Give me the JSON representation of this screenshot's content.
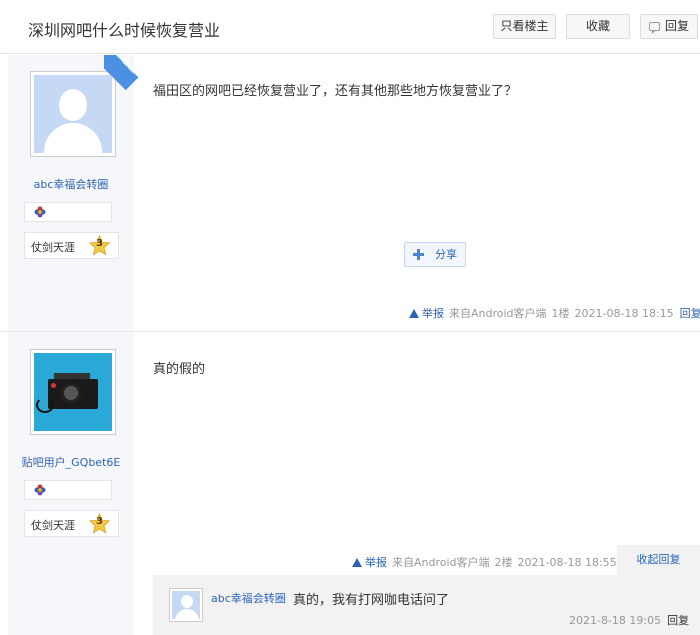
{
  "header": {
    "title": "深圳网吧什么时候恢复营业",
    "only_op_label": "只看楼主",
    "favorite_label": "收藏",
    "reply_label": "回复"
  },
  "posts": [
    {
      "username": "abc幸福会转圈",
      "level_name": "仗剑天涯",
      "level": "3",
      "op_badge": "楼主",
      "content": "福田区的网吧已经恢复营业了，还有其他那些地方恢复营业了？",
      "share_label": "分享",
      "report_label": "举报",
      "client": "来自Android客户端",
      "floor": "1楼",
      "time": "2021-08-18 18:15",
      "reply_label": "回复"
    },
    {
      "username": "贴吧用户_GQbet6E",
      "level_name": "仗剑天涯",
      "level": "3",
      "content": "真的假的",
      "report_label": "举报",
      "client": "来自Android客户端",
      "floor": "2楼",
      "time": "2021-08-18 18:55",
      "collapse_label": "收起回复",
      "subreply": {
        "username": "abc幸福会转圈",
        "text": "真的，我有打网咖电话问了",
        "time": "2021-8-18 19:05",
        "reply_label": "回复"
      }
    }
  ],
  "colors": {
    "link": "#2d64b3",
    "sidebar": "#f6f7fa",
    "badge": "#4b90e2"
  }
}
